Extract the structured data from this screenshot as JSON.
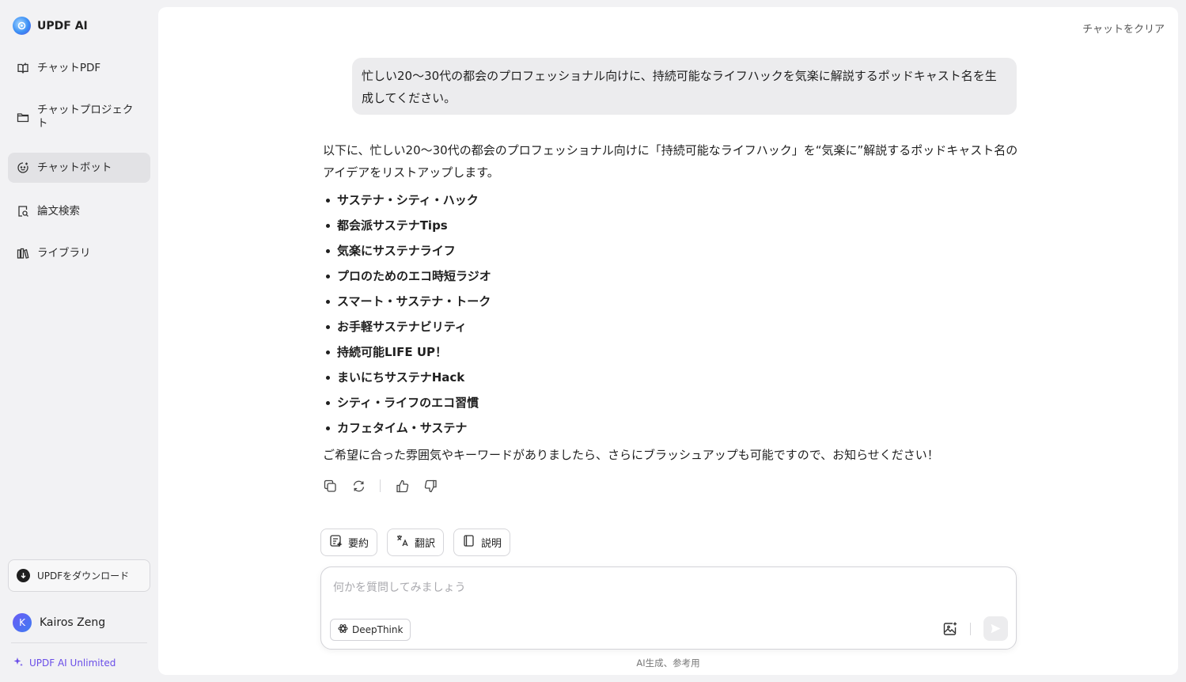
{
  "app": {
    "name": "UPDF AI"
  },
  "sidebar": {
    "items": [
      {
        "label": "チャットPDF",
        "icon": "book-icon"
      },
      {
        "label": "チャットプロジェクト",
        "icon": "folder-icon"
      },
      {
        "label": "チャットボット",
        "icon": "chatbot-icon",
        "active": true
      },
      {
        "label": "論文検索",
        "icon": "paper-search-icon"
      },
      {
        "label": "ライブラリ",
        "icon": "library-icon"
      }
    ],
    "download_label": "UPDFをダウンロード",
    "user": {
      "initial": "K",
      "name": "Kairos Zeng"
    },
    "plan_label": "UPDF AI Unlimited"
  },
  "main": {
    "clear_chat": "チャットをクリア",
    "user_message": "忙しい20〜30代の都会のプロフェッショナル向けに、持続可能なライフハックを気楽に解説するポッドキャスト名を生成してください。",
    "answer": {
      "intro": "以下に、忙しい20〜30代の都会のプロフェッショナル向けに「持続可能なライフハック」を“気楽に”解説するポッドキャスト名のアイデアをリストアップします。",
      "items": [
        "サステナ・シティ・ハック",
        "都会派サステナTips",
        "気楽にサステナライフ",
        "プロのためのエコ時短ラジオ",
        "スマート・サステナ・トーク",
        "お手軽サステナビリティ",
        "持続可能LIFE UP！",
        "まいにちサステナHack",
        "シティ・ライフのエコ習慣",
        "カフェタイム・サステナ"
      ],
      "outro": "ご希望に合った雰囲気やキーワードがありましたら、さらにブラッシュアップも可能ですので、お知らせください！"
    },
    "quick_actions": [
      {
        "label": "要約",
        "icon": "summary-icon"
      },
      {
        "label": "翻訳",
        "icon": "translate-icon"
      },
      {
        "label": "説明",
        "icon": "explain-icon"
      }
    ],
    "composer": {
      "placeholder": "何かを質問してみましょう",
      "deepthink_label": "DeepThink"
    },
    "disclaimer": "AI生成、参考用"
  }
}
